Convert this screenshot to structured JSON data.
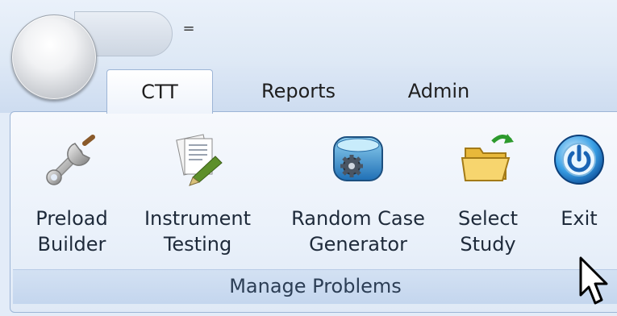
{
  "tabs": [
    {
      "label": "CTT",
      "selected": true
    },
    {
      "label": "Reports",
      "selected": false
    },
    {
      "label": "Admin",
      "selected": false
    }
  ],
  "qat": {
    "dropdown_glyph": "="
  },
  "ribbon": {
    "group_label": "Manage Problems",
    "buttons": [
      {
        "line1": "Preload",
        "line2": "Builder",
        "icon": "wrench-icon"
      },
      {
        "line1": "Instrument",
        "line2": "Testing",
        "icon": "documents-pen-icon"
      },
      {
        "line1": "Random Case",
        "line2": "Generator",
        "icon": "generator-gear-icon"
      },
      {
        "line1": "Select",
        "line2": "Study",
        "icon": "folder-arrow-icon"
      },
      {
        "line1": "Exit",
        "line2": "",
        "icon": "power-icon"
      }
    ]
  },
  "colors": {
    "accent": "#2a6fd6",
    "tab_border": "#9db5d6",
    "ribbon_bg": "#eaf1fa"
  }
}
